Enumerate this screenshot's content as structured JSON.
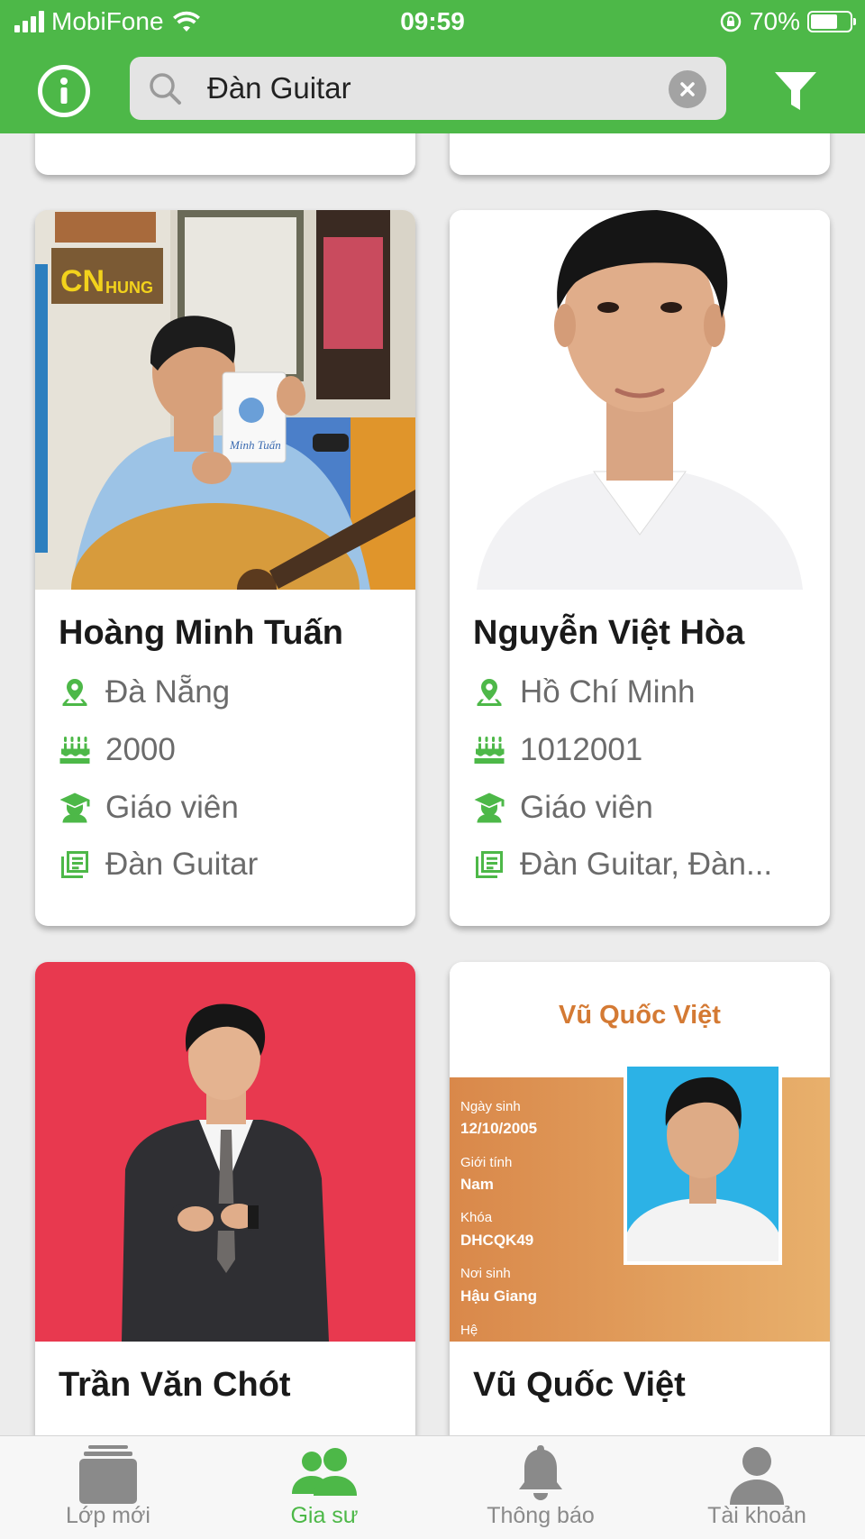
{
  "status_bar": {
    "carrier": "MobiFone",
    "time": "09:59",
    "battery": "70%",
    "battery_level": 0.7
  },
  "search": {
    "query": "Đàn Guitar"
  },
  "icons": {
    "info": "info-icon",
    "search": "search-icon",
    "clear": "clear-icon",
    "filter": "filter-icon",
    "location": "location-pin-icon",
    "birthday": "birthday-cake-icon",
    "occupation": "graduate-icon",
    "subject": "book-icon"
  },
  "colors": {
    "brand": "#4db848",
    "text_dark": "#1a1a1a",
    "text_muted": "#6b6b6b",
    "nav_inactive": "#8a8a8a"
  },
  "tutors": [
    {
      "name": "Hoàng Minh Tuấn",
      "location": "Đà Nẵng",
      "birth": "2000",
      "occupation": "Giáo viên",
      "subject": "Đàn Guitar",
      "notebook_text": "Minh Tuấn"
    },
    {
      "name": "Nguyễn Việt Hòa",
      "location": "Hồ Chí Minh",
      "birth": "1012001",
      "occupation": "Giáo viên",
      "subject": "Đàn Guitar, Đàn..."
    },
    {
      "name": "Trần Văn Chót"
    },
    {
      "name": "Vũ Quốc Việt",
      "id_card": {
        "title": "Vũ Quốc Việt",
        "dob_label": "Ngày sinh",
        "dob": "12/10/2005",
        "gender_label": "Giới tính",
        "gender": "Nam",
        "course_label": "Khóa",
        "course": "DHCQK49",
        "birthplace_label": "Nơi sinh",
        "birthplace": "Hậu Giang",
        "system_label": "Hệ"
      }
    }
  ],
  "bottom_nav": [
    {
      "label": "Lớp mới",
      "icon": "classes-icon",
      "active": false
    },
    {
      "label": "Gia sư",
      "icon": "tutors-icon",
      "active": true
    },
    {
      "label": "Thông báo",
      "icon": "bell-icon",
      "active": false
    },
    {
      "label": "Tài khoản",
      "icon": "account-icon",
      "active": false
    }
  ]
}
